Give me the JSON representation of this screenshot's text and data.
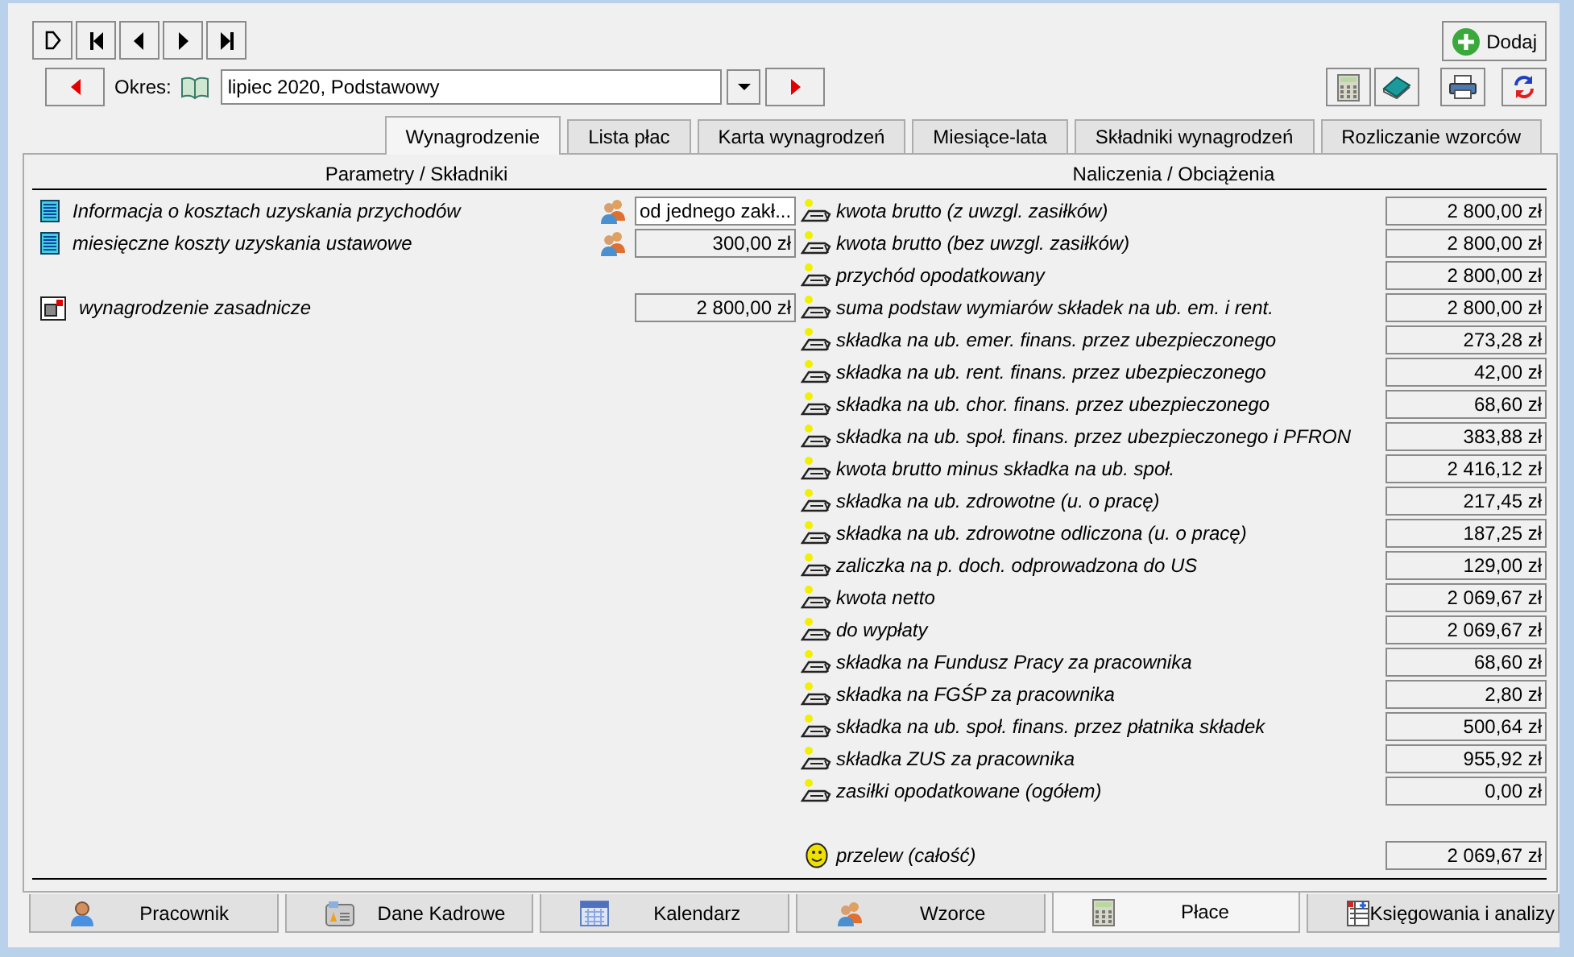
{
  "add_button": {
    "label": "Dodaj"
  },
  "period": {
    "label": "Okres:",
    "value": "lipiec 2020, Podstawowy"
  },
  "tabs": [
    {
      "label": "Wynagrodzenie",
      "selected": true
    },
    {
      "label": "Lista płac",
      "selected": false
    },
    {
      "label": "Karta wynagrodzeń",
      "selected": false
    },
    {
      "label": "Miesiące-lata",
      "selected": false
    },
    {
      "label": "Składniki wynagrodzeń",
      "selected": false
    },
    {
      "label": "Rozliczanie wzorców",
      "selected": false
    }
  ],
  "left_header": "Parametry / Składniki",
  "right_header": "Naliczenia / Obciążenia",
  "parameters": [
    {
      "label": "Informacja o kosztach uzyskania przychodów",
      "kind": "text",
      "value": "od jednego zakł..."
    },
    {
      "label": "miesięczne koszty uzyskania ustawowe",
      "kind": "amount",
      "value": "300,00 zł"
    }
  ],
  "components": [
    {
      "label": "wynagrodzenie zasadnicze",
      "value": "2 800,00 zł"
    }
  ],
  "charges": [
    {
      "label": "kwota brutto (z uwzgl. zasiłków)",
      "value": "2 800,00 zł"
    },
    {
      "label": "kwota brutto (bez uwzgl. zasiłków)",
      "value": "2 800,00 zł"
    },
    {
      "label": "przychód opodatkowany",
      "value": "2 800,00 zł"
    },
    {
      "label": "suma podstaw wymiarów składek na ub. em. i rent.",
      "value": "2 800,00 zł"
    },
    {
      "label": "składka na ub. emer. finans. przez ubezpieczonego",
      "value": "273,28 zł"
    },
    {
      "label": "składka na ub. rent. finans. przez ubezpieczonego",
      "value": "42,00 zł"
    },
    {
      "label": "składka na ub. chor. finans. przez ubezpieczonego",
      "value": "68,60 zł"
    },
    {
      "label": "składka na ub. społ. finans. przez ubezpieczonego i PFRON",
      "value": "383,88 zł"
    },
    {
      "label": "kwota brutto minus składka na ub. społ.",
      "value": "2 416,12 zł"
    },
    {
      "label": "składka na ub. zdrowotne (u. o pracę)",
      "value": "217,45 zł"
    },
    {
      "label": "składka na ub. zdrowotne odliczona (u. o pracę)",
      "value": "187,25 zł"
    },
    {
      "label": "zaliczka na p. doch. odprowadzona do US",
      "value": "129,00 zł"
    },
    {
      "label": "kwota netto",
      "value": "2 069,67 zł"
    },
    {
      "label": "do wypłaty",
      "value": "2 069,67 zł"
    },
    {
      "label": "składka na Fundusz Pracy za pracownika",
      "value": "68,60 zł"
    },
    {
      "label": "składka na FGŚP za pracownika",
      "value": "2,80 zł"
    },
    {
      "label": "składka na ub. społ. finans. przez płatnika składek",
      "value": "500,64 zł"
    },
    {
      "label": "składka ZUS za pracownika",
      "value": "955,92 zł"
    },
    {
      "label": "zasiłki opodatkowane (ogółem)",
      "value": "0,00 zł"
    }
  ],
  "transfer": {
    "label": "przelew (całość)",
    "value": "2 069,67 zł"
  },
  "bottom_tabs": [
    {
      "label": "Pracownik",
      "kind": "person",
      "selected": false
    },
    {
      "label": "Dane Kadrowe",
      "kind": "card",
      "selected": false
    },
    {
      "label": "Kalendarz",
      "kind": "calendar",
      "selected": false
    },
    {
      "label": "Wzorce",
      "kind": "people",
      "selected": false
    },
    {
      "label": "Płace",
      "kind": "calculator",
      "selected": true
    },
    {
      "label": "Księgowania i analizy",
      "kind": "ledger",
      "selected": false
    }
  ]
}
